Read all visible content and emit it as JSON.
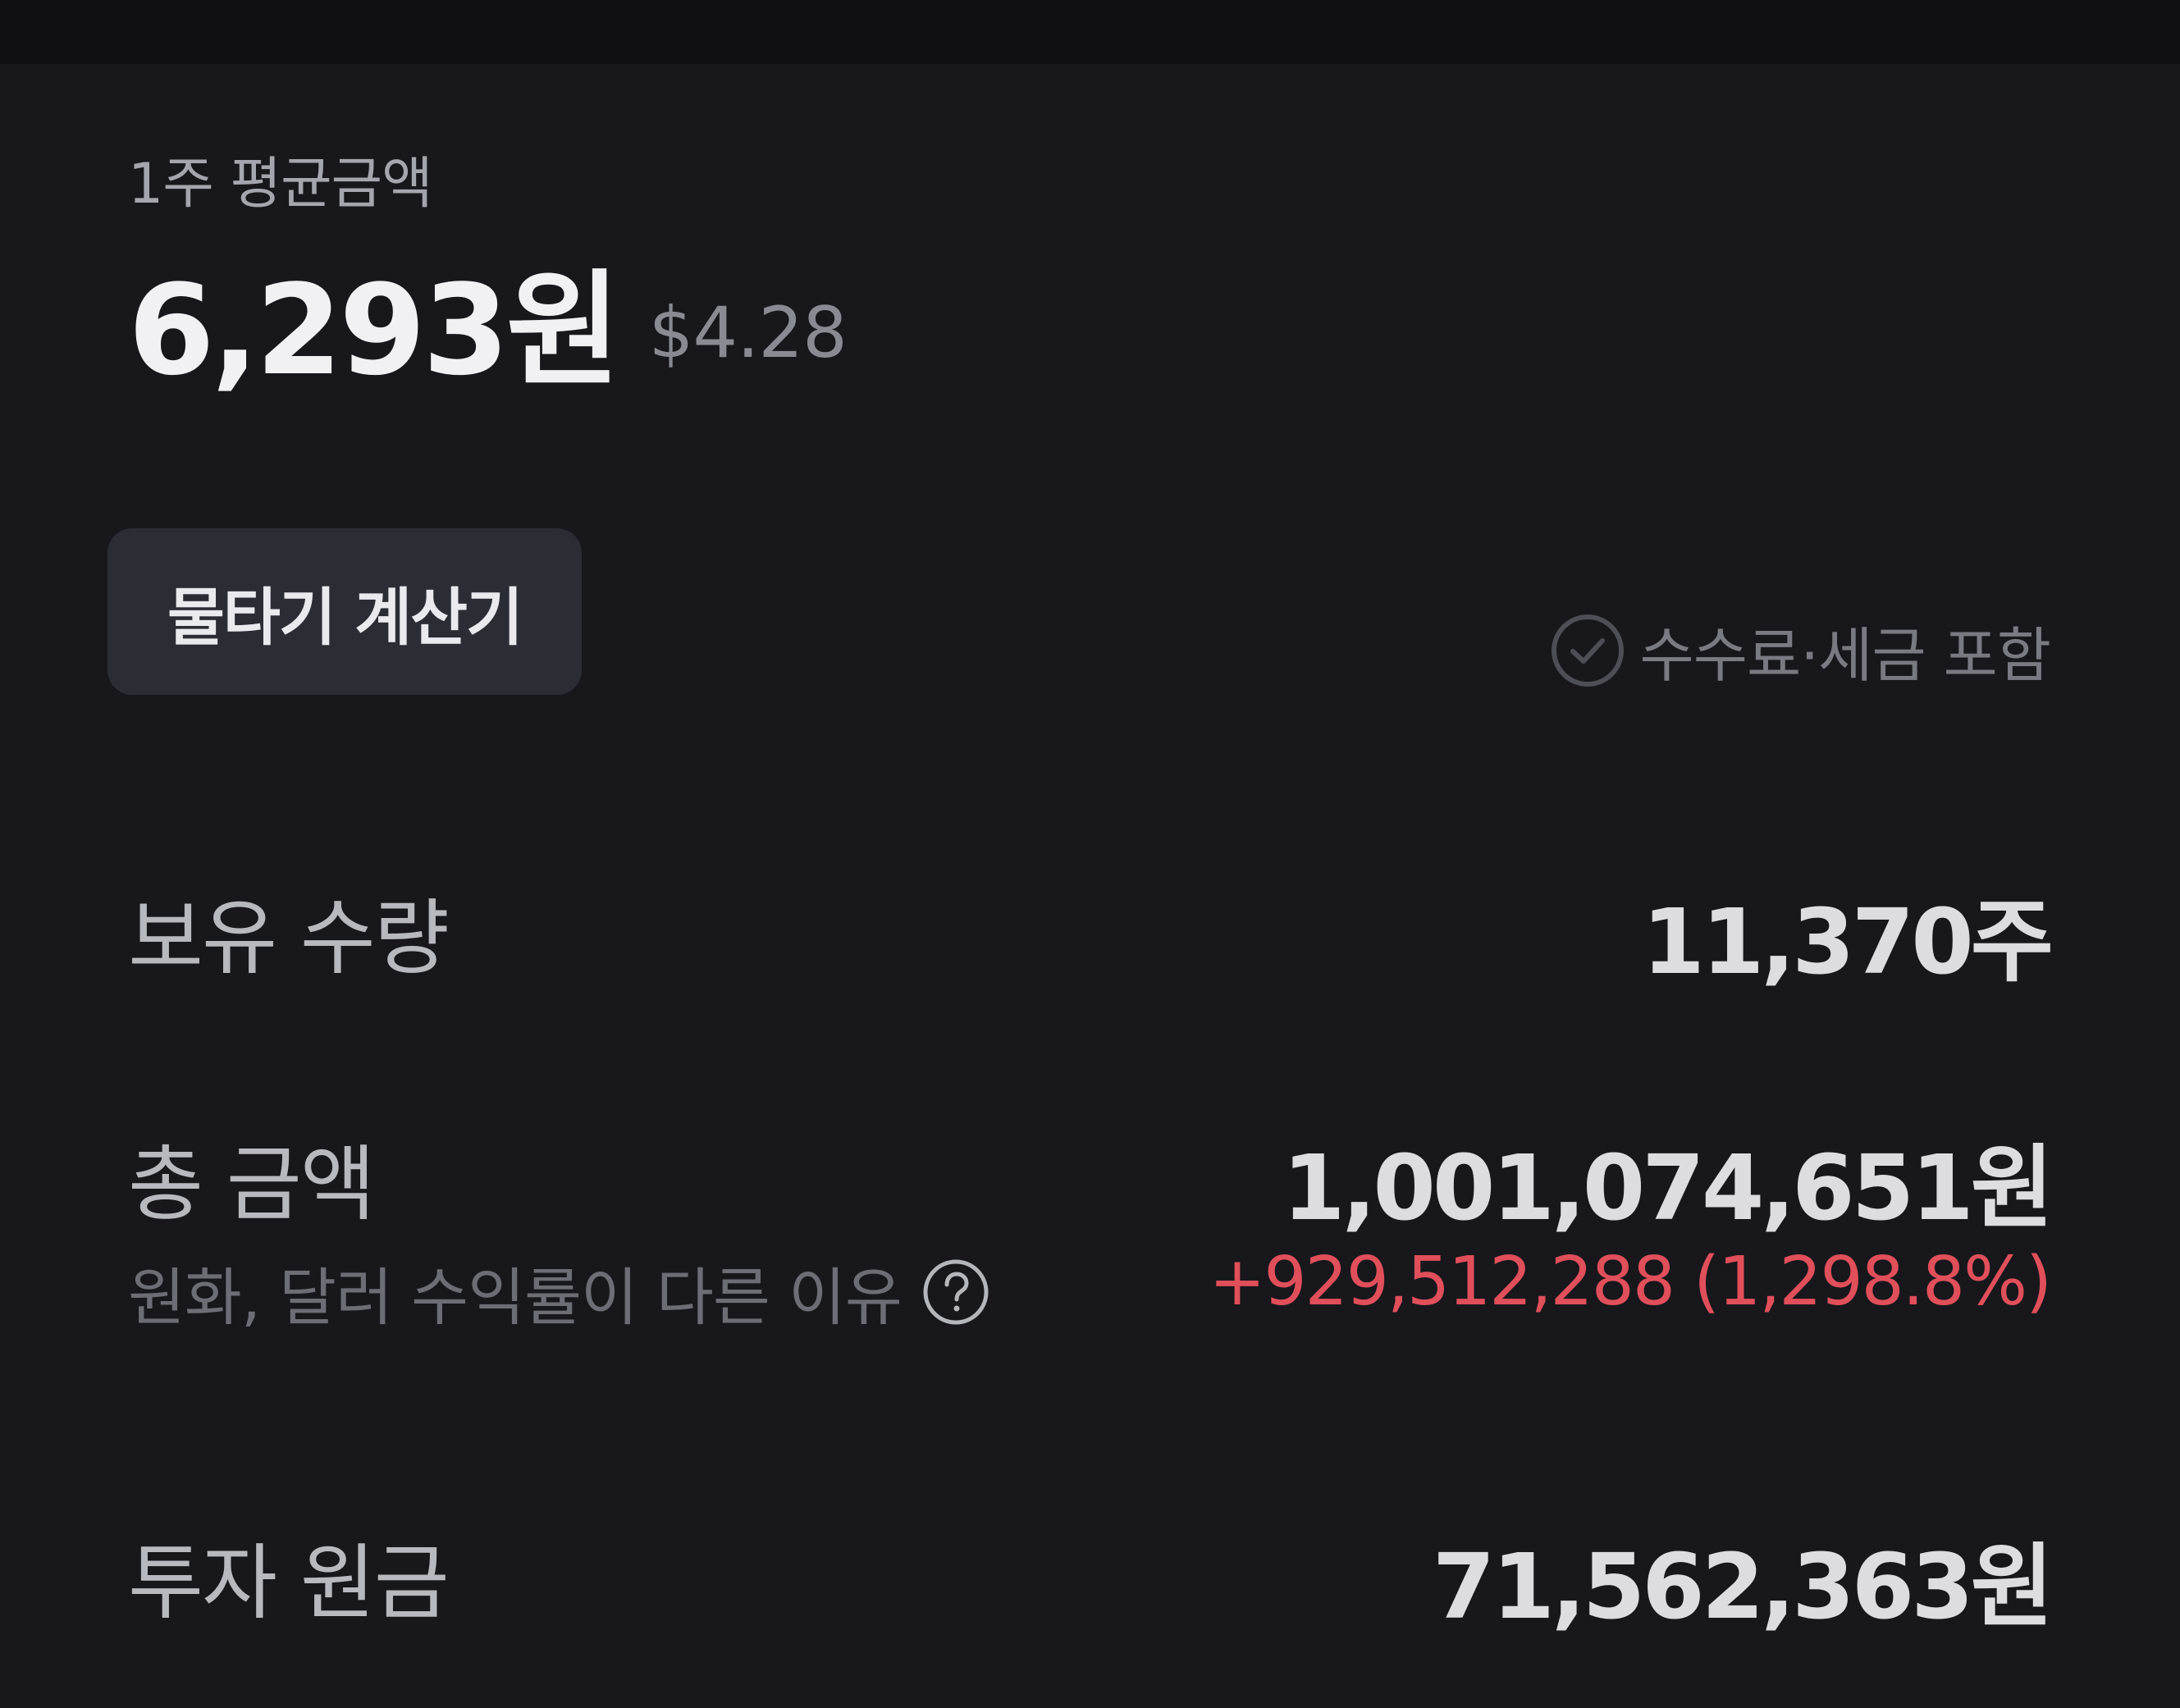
{
  "average_price": {
    "label": "1주 평균금액",
    "krw": "6,293원",
    "usd": "$4.28"
  },
  "calculator_button": {
    "label": "물타기 계산기"
  },
  "fee_toggle": {
    "label": "수수료·세금 포함",
    "icon": "check-circle-icon",
    "checked": false
  },
  "holdings": {
    "label": "보유 수량",
    "value": "11,370주"
  },
  "total_amount": {
    "label": "총 금액",
    "value": "1,001,074,651원",
    "sub_label": "원화, 달러 수익률이 다른 이유",
    "help_icon": "question-circle-icon",
    "profit": "+929,512,288 (1,298.8%)"
  },
  "principal": {
    "label": "투자 원금",
    "value": "71,562,363원"
  },
  "colors": {
    "background": "#17171c",
    "button_background": "#2c2c35",
    "profit_red": "#e04f5a",
    "muted_text": "#7a7a82"
  }
}
